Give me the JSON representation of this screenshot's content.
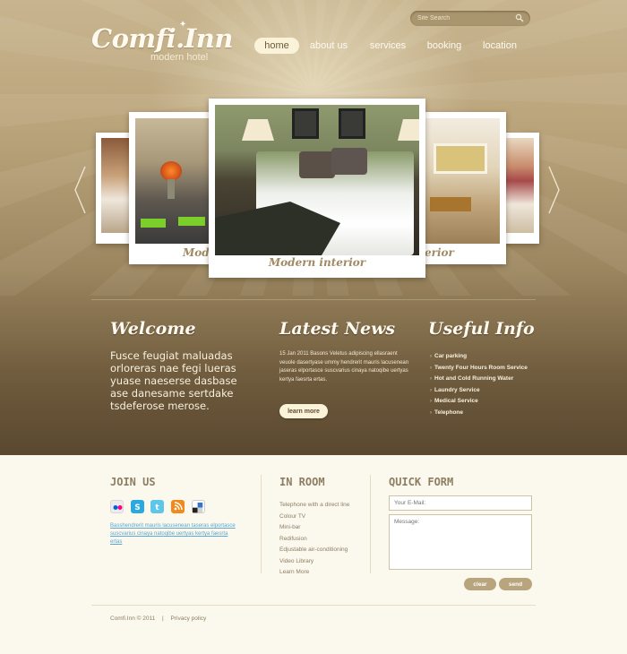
{
  "brand": {
    "logo_text": "Comfi.Inn",
    "tagline": "modern hotel"
  },
  "search": {
    "placeholder": "Site Search"
  },
  "nav": {
    "items": [
      "home",
      "about us",
      "services",
      "booking",
      "location"
    ],
    "active": "home"
  },
  "carousel": {
    "captions": [
      "Modern interior",
      "Modern interior",
      "Modern interior"
    ],
    "main_caption": "Modern interior",
    "left_caption": "Mode",
    "right_caption": "erior"
  },
  "welcome": {
    "heading": "Welcome",
    "text": "Fusce feugiat maluadas orloreras nae fegi lueras yuase naeserse dasbase ase danesame sertdake tsdeferose merose."
  },
  "news": {
    "heading": "Latest News",
    "text": "15 Jan 2011 Basons Veletus adipiscing ellasraent veuole dasertyase ummy hendrerit mauris lacusenean jaseras elportasce suscvarius cinaya natoqibe uertyas kertya faesrta ertas.",
    "button": "learn more"
  },
  "useful_info": {
    "heading": "Useful Info",
    "items": [
      "Car parking",
      "Twenty Four Hours Room Service",
      "Hot and Cold Running Water",
      "Laundry Service",
      "Medical Service",
      "Telephone"
    ]
  },
  "join_us": {
    "heading": "JOIN US",
    "social_icons": [
      "flickr-icon",
      "skype-icon",
      "twitter-icon",
      "rss-icon",
      "delicious-icon"
    ],
    "links_text": "Basshendrerit mauris lacusenean taseras elportasce suscvarius cinaya natoqibe uertyas kertya faesrta ertas"
  },
  "in_room": {
    "heading": "IN ROOM",
    "items": [
      "Telephone with a direct line",
      "Colour TV",
      "Mini-bar",
      "Redifusion",
      "Edjustable air-conditioning",
      "Video Library",
      "Learn More"
    ]
  },
  "quick_form": {
    "heading": "QUICK FORM",
    "email_placeholder": "Your E-Mail:",
    "message_placeholder": "Message:",
    "clear_label": "clear",
    "send_label": "send"
  },
  "footer": {
    "copyright": "Comfi.Inn © 2011",
    "divider": "|",
    "privacy": "Privacy policy"
  },
  "colors": {
    "accent": "#fbf3d9",
    "brown_dark": "#5a482f",
    "heading_bottom": "#8d7e62",
    "button_tan": "#b8a57d",
    "link_blue": "#5aa7cf"
  }
}
